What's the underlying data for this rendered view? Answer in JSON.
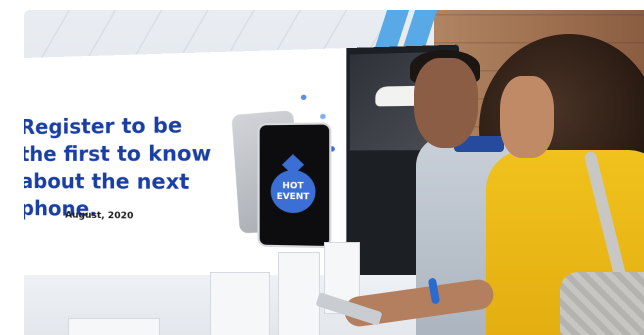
{
  "display": {
    "headline_lines": [
      "Register to be",
      "the first to know",
      "about the next phone."
    ],
    "date": "August, 2020",
    "badge_line1": "HOT",
    "badge_line2": "EVENT"
  },
  "colors": {
    "headline": "#1a3fa4",
    "badge": "#3b6fd6",
    "shirt_accent": "#254a9e",
    "top": "#f0c21d"
  }
}
